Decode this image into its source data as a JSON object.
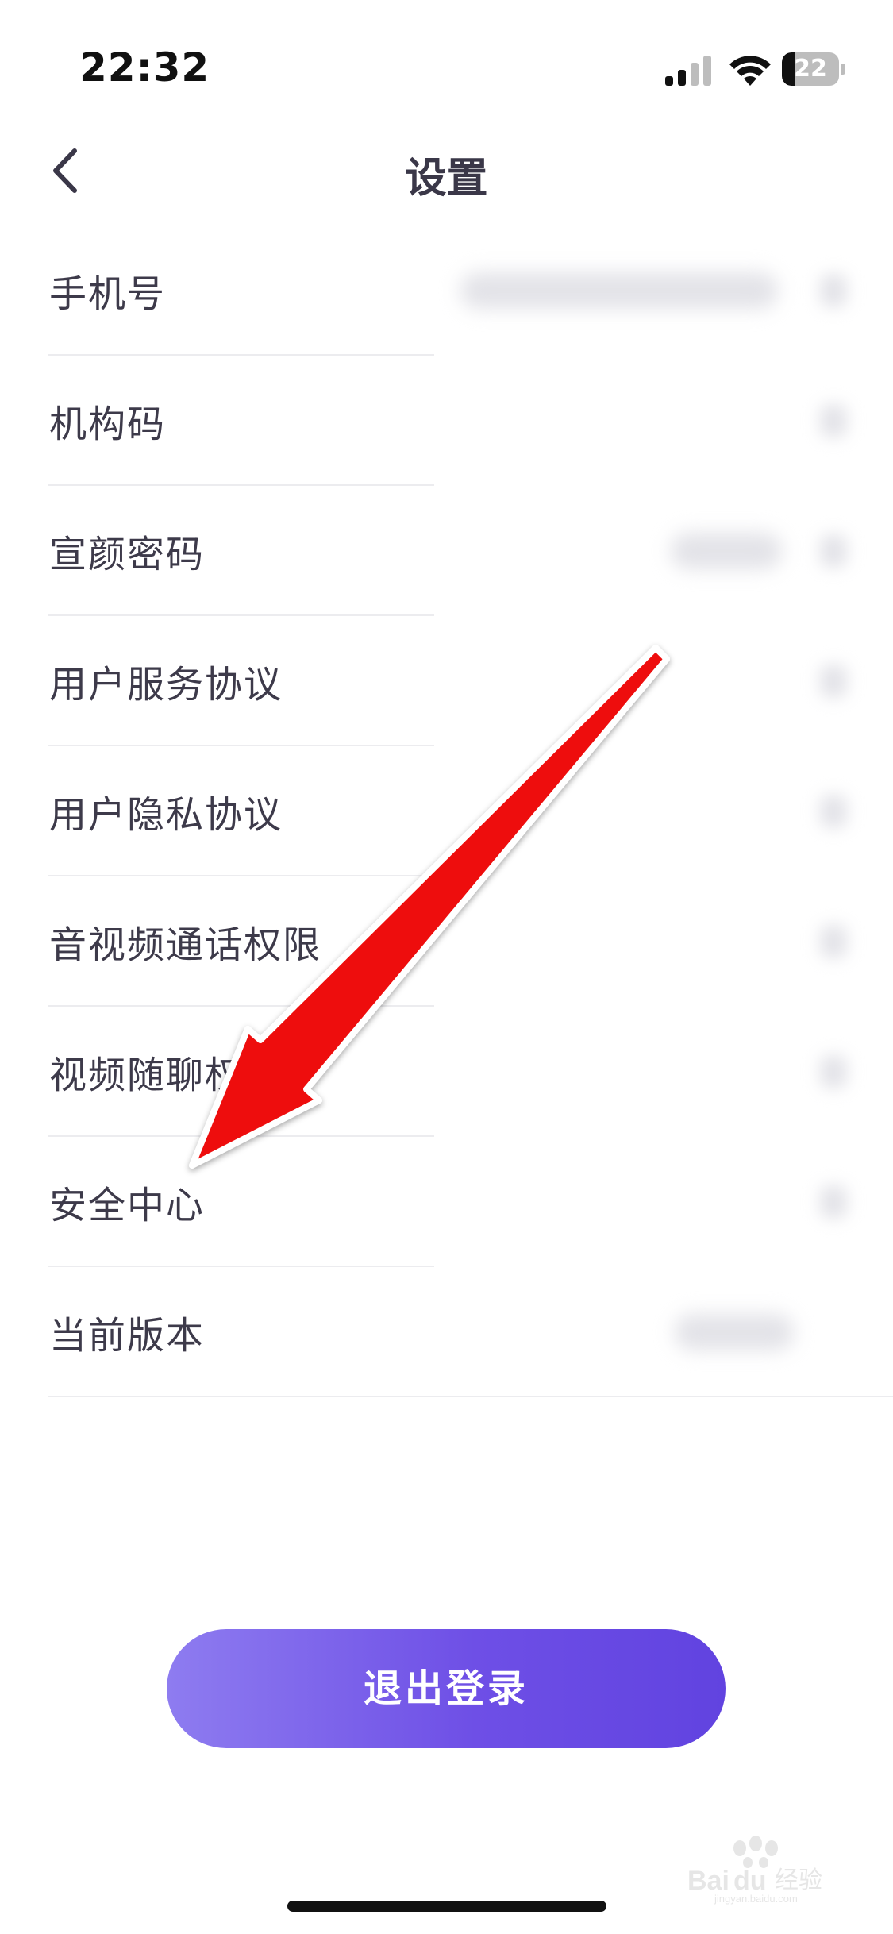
{
  "status_bar": {
    "time": "22:32",
    "battery_level": "22",
    "battery_fraction": 0.22
  },
  "nav": {
    "title": "设置"
  },
  "settings": {
    "items": [
      {
        "label": "手机号"
      },
      {
        "label": "机构码"
      },
      {
        "label": "宣颜密码"
      },
      {
        "label": "用户服务协议"
      },
      {
        "label": "用户隐私协议"
      },
      {
        "label": "音视频通话权限"
      },
      {
        "label": "视频随聊权限"
      },
      {
        "label": "安全中心"
      },
      {
        "label": "当前版本"
      }
    ]
  },
  "logout": {
    "label": "退出登录"
  },
  "colors": {
    "accent_start": "#8e7cf0",
    "accent_end": "#6143e0",
    "annotation_arrow": "#ee1111"
  },
  "icons": {
    "back": "chevron-left-icon",
    "signal": "cellular-signal-icon",
    "wifi": "wifi-icon",
    "battery": "battery-icon"
  }
}
